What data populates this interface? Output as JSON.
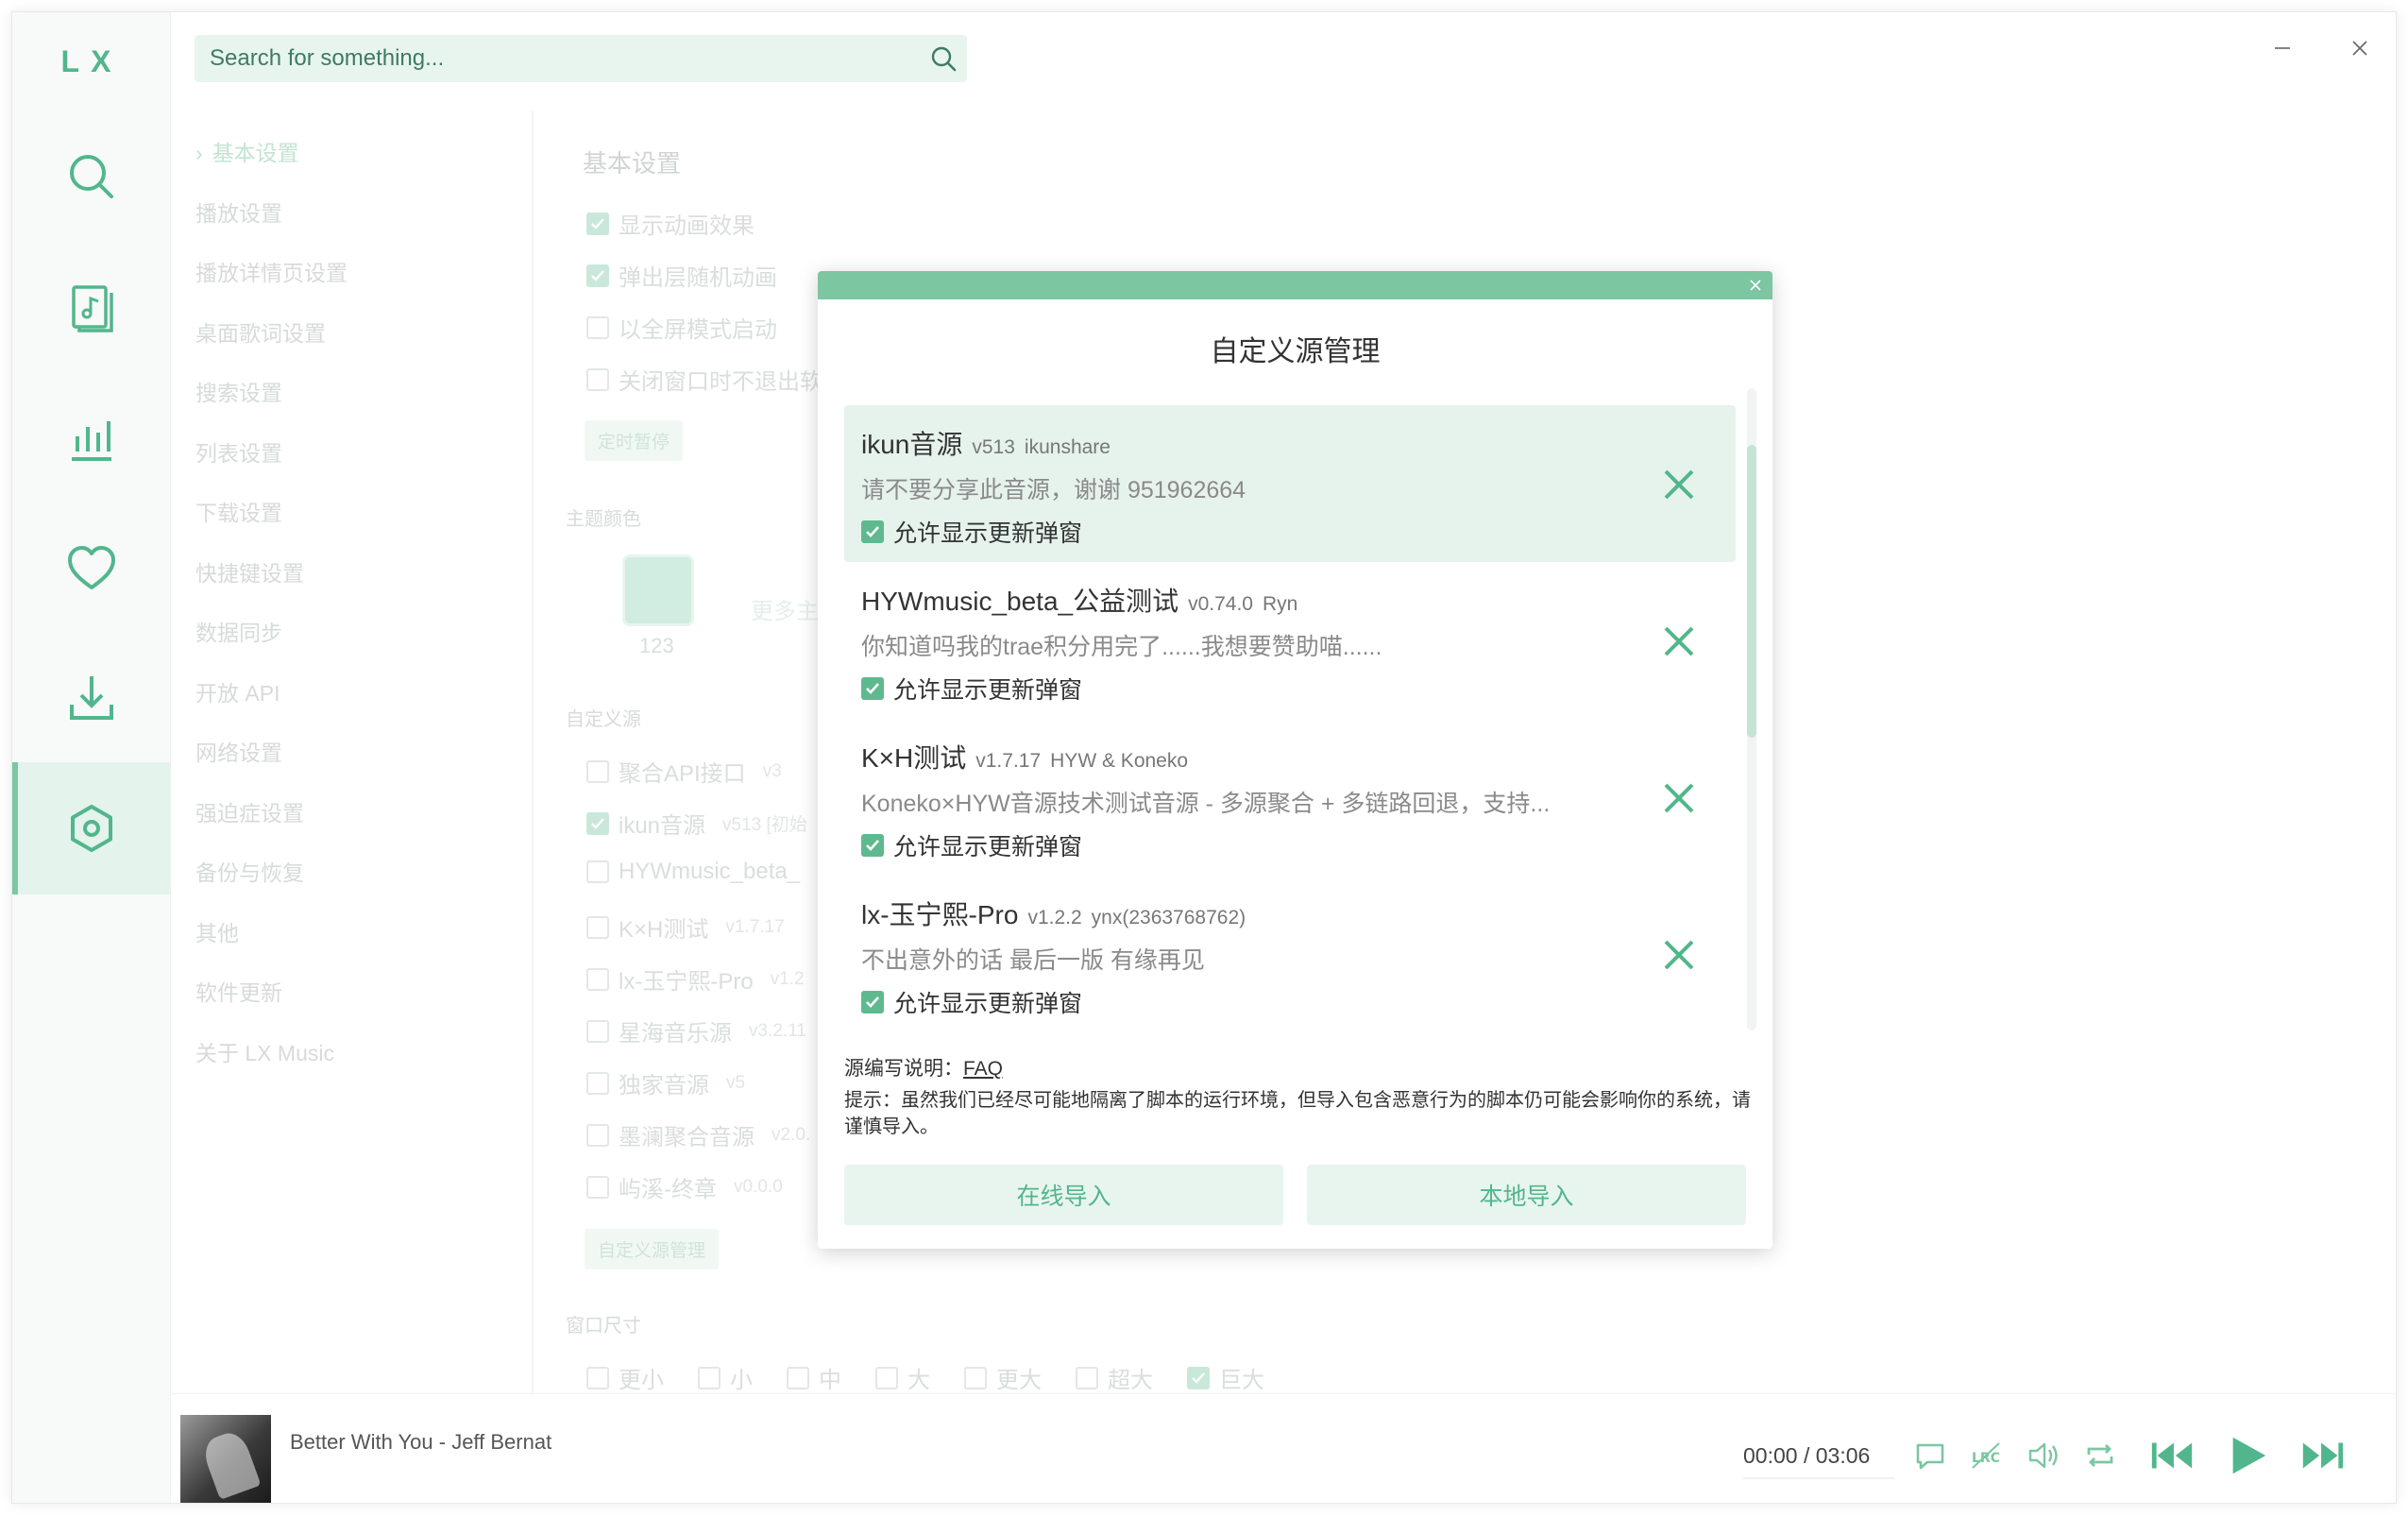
{
  "app": {
    "logo": "LX",
    "window_controls": [
      "minimize-icon",
      "close-icon"
    ]
  },
  "search": {
    "placeholder": "Search for something..."
  },
  "rail": {
    "items": [
      "search-icon",
      "songlist-icon",
      "leaderboard-icon",
      "heart-icon",
      "download-icon",
      "settings-icon"
    ],
    "active": "settings-icon"
  },
  "settings_nav": {
    "items": [
      "基本设置",
      "播放设置",
      "播放详情页设置",
      "桌面歌词设置",
      "搜索设置",
      "列表设置",
      "下载设置",
      "快捷键设置",
      "数据同步",
      "开放 API",
      "网络设置",
      "强迫症设置",
      "备份与恢复",
      "其他",
      "软件更新",
      "关于 LX Music"
    ],
    "active_index": 0
  },
  "settings_content": {
    "basic_title": "基本设置",
    "basic_options": [
      {
        "label": "显示动画效果",
        "checked": true
      },
      {
        "label": "弹出层随机动画",
        "checked": true
      },
      {
        "label": "以全屏模式启动",
        "checked": false
      },
      {
        "label": "关闭窗口时不退出软",
        "checked": false
      }
    ],
    "timer_button": "定时暂停",
    "theme_title": "主题颜色",
    "theme_swatch_label": "123",
    "theme_more": "更多主",
    "custom_source_title": "自定义源",
    "custom_sources": [
      {
        "label": "聚合API接口",
        "version": "v3",
        "checked": false
      },
      {
        "label": "ikun音源",
        "version": "v513 [初始",
        "checked": true
      },
      {
        "label": "HYWmusic_beta_",
        "version": "",
        "checked": false
      },
      {
        "label": "K×H测试",
        "version": "v1.7.17",
        "checked": false
      },
      {
        "label": "lx-玉宁熙-Pro",
        "version": "v1.2",
        "checked": false
      },
      {
        "label": "星海音乐源",
        "version": "v3.2.11",
        "checked": false
      },
      {
        "label": "独家音源",
        "version": "v5",
        "checked": false
      },
      {
        "label": "墨澜聚合音源",
        "version": "v2.0.",
        "checked": false
      },
      {
        "label": "屿溪-终章",
        "version": "v0.0.0",
        "checked": false
      }
    ],
    "custom_source_button": "自定义源管理",
    "window_size_title": "窗口尺寸",
    "window_sizes": [
      {
        "label": "更小",
        "checked": false
      },
      {
        "label": "小",
        "checked": false
      },
      {
        "label": "中",
        "checked": false
      },
      {
        "label": "大",
        "checked": false
      },
      {
        "label": "更大",
        "checked": false
      },
      {
        "label": "超大",
        "checked": false
      },
      {
        "label": "巨大",
        "checked": true
      }
    ]
  },
  "modal": {
    "title": "自定义源管理",
    "sources": [
      {
        "name": "ikun音源",
        "version": "v513",
        "author": "ikunshare",
        "description": "请不要分享此音源，谢谢 951962664",
        "allow_update_label": "允许显示更新弹窗",
        "allow_update": true,
        "selected": true
      },
      {
        "name": "HYWmusic_beta_公益测试",
        "version": "v0.74.0",
        "author": "Ryn",
        "description": "你知道吗我的trae积分用完了......我想要赞助喵......",
        "allow_update_label": "允许显示更新弹窗",
        "allow_update": true,
        "selected": false
      },
      {
        "name": "K×H测试",
        "version": "v1.7.17",
        "author": "HYW & Koneko",
        "description": "Koneko×HYW音源技术测试音源 - 多源聚合 + 多链路回退，支持...",
        "allow_update_label": "允许显示更新弹窗",
        "allow_update": true,
        "selected": false
      },
      {
        "name": "lx-玉宁熙-Pro",
        "version": "v1.2.2",
        "author": "ynx(2363768762)",
        "description": "不出意外的话 最后一版 有缘再见",
        "allow_update_label": "允许显示更新弹窗",
        "allow_update": true,
        "selected": false
      }
    ],
    "faq_prefix": "源编写说明：",
    "faq_link": "FAQ",
    "tip": "提示：虽然我们已经尽可能地隔离了脚本的运行环境，但导入包含恶意行为的脚本仍可能会影响你的系统，请谨慎导入。",
    "online_import": "在线导入",
    "local_import": "本地导入"
  },
  "player": {
    "track": "Better With You - Jeff Bernat",
    "time_current": "00:00",
    "time_separator": "/",
    "time_total": "03:06",
    "controls": [
      "comment-icon",
      "lyric-icon",
      "volume-icon",
      "repeat-icon",
      "previous-icon",
      "play-icon",
      "next-icon"
    ]
  },
  "colors": {
    "accent": "#52b68c",
    "accent_light": "#e8f5ef",
    "modal_bar": "#7cc6a2"
  }
}
